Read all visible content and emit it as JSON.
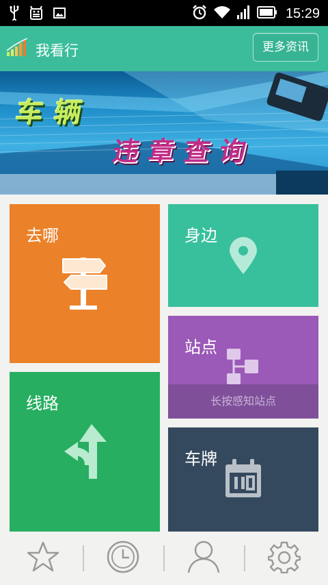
{
  "status_bar": {
    "time": "15:29",
    "icons": [
      "usb-icon",
      "android-debug-icon",
      "image-icon",
      "alarm-icon",
      "wifi-icon",
      "signal-icon",
      "battery-icon"
    ]
  },
  "app_bar": {
    "title": "我看行",
    "more_button": "更多资讯"
  },
  "banner": {
    "line1": "车辆",
    "line2": "违章查询"
  },
  "tiles": {
    "go": {
      "label": "去哪",
      "icon": "signpost-icon",
      "color": "#eb8128"
    },
    "nearby": {
      "label": "身边",
      "icon": "location-pin-icon",
      "color": "#38c09c"
    },
    "station": {
      "label": "站点",
      "icon": "hierarchy-icon",
      "hint": "长按感知站点",
      "color": "#9b59b8"
    },
    "route": {
      "label": "线路",
      "icon": "route-arrows-icon",
      "color": "#27ae60"
    },
    "plate": {
      "label": "车牌",
      "icon": "calendar-icon",
      "color": "#34495e"
    }
  },
  "bottom_nav": [
    "star-icon",
    "clock-icon",
    "user-icon",
    "gear-icon"
  ]
}
